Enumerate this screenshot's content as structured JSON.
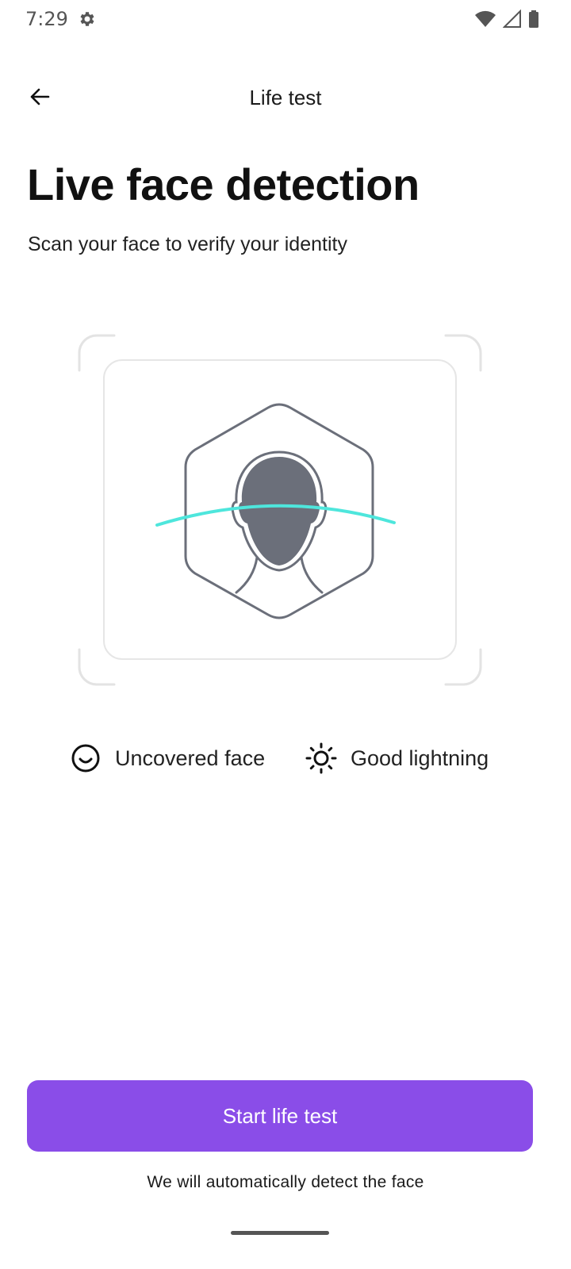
{
  "status_bar": {
    "time": "7:29",
    "icons": [
      "gear-icon",
      "wifi-icon",
      "signal-icon",
      "battery-icon"
    ]
  },
  "app_bar": {
    "title": "Life test",
    "back_icon": "arrow-left-icon"
  },
  "content": {
    "headline": "Live face detection",
    "subheadline": "Scan your face to verify your identity"
  },
  "illustration": {
    "icon": "face-scan-icon",
    "scan_line_color": "#4ee6dc",
    "outline_color": "#6b6f7a"
  },
  "tips": [
    {
      "icon": "smile-icon",
      "label": "Uncovered face"
    },
    {
      "icon": "sun-icon",
      "label": "Good lightning"
    }
  ],
  "primary_button": {
    "label": "Start life test",
    "color": "#8a4de8"
  },
  "helper_text": "We will automatically detect the face"
}
